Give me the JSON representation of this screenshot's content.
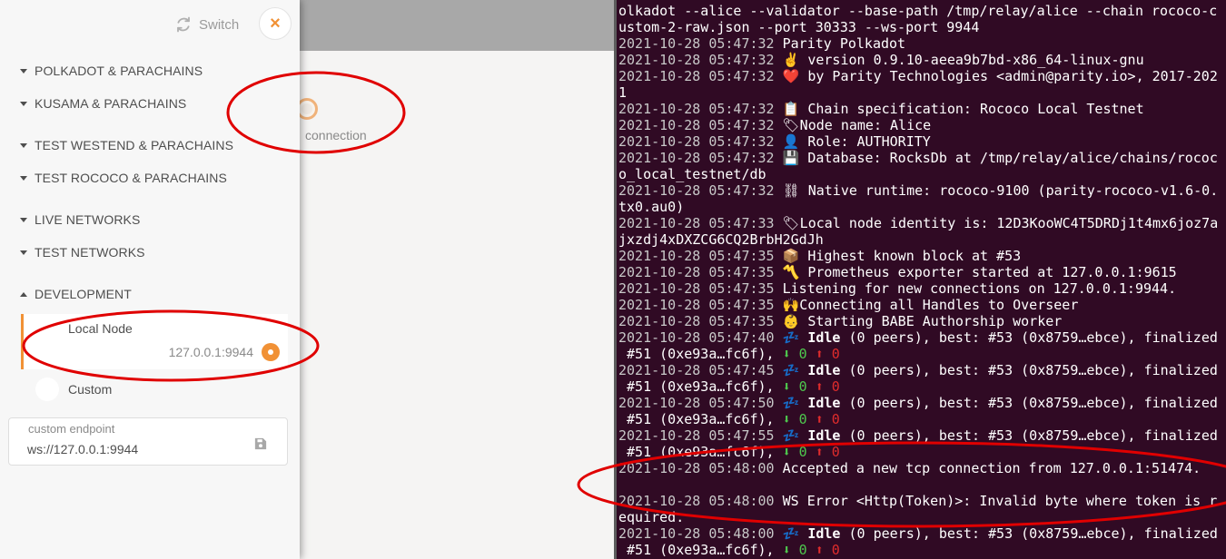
{
  "sidebar": {
    "switch_label": "Switch",
    "close_label": "×",
    "groups": [
      {
        "label": "POLKADOT & PARACHAINS",
        "expanded": false
      },
      {
        "label": "KUSAMA & PARACHAINS",
        "expanded": false
      },
      {
        "label": "TEST WESTEND & PARACHAINS",
        "expanded": false
      },
      {
        "label": "TEST ROCOCO & PARACHAINS",
        "expanded": false
      },
      {
        "label": "LIVE NETWORKS",
        "expanded": false
      },
      {
        "label": "TEST NETWORKS",
        "expanded": false
      },
      {
        "label": "DEVELOPMENT",
        "expanded": true
      }
    ],
    "local_node": {
      "name": "Local Node",
      "url": "127.0.0.1:9944",
      "selected": true
    },
    "custom_node": {
      "name": "Custom",
      "selected": false
    },
    "custom_endpoint": {
      "label": "custom endpoint",
      "value": "ws://127.0.0.1:9944"
    }
  },
  "app": {
    "connection_label": "connection"
  },
  "terminal": {
    "lines": [
      "olkadot --alice --validator --base-path /tmp/relay/alice --chain rococo-c",
      "ustom-2-raw.json --port 30333 --ws-port 9944",
      "2021-10-28 05:47:32 Parity Polkadot",
      "2021-10-28 05:47:32 ✌️ version 0.9.10-aeea9b7bd-x86_64-linux-gnu",
      "2021-10-28 05:47:32 ❤️ by Parity Technologies <admin@parity.io>, 2017-202",
      "1",
      "2021-10-28 05:47:32 📋 Chain specification: Rococo Local Testnet",
      "2021-10-28 05:47:32 🏷Node name: Alice",
      "2021-10-28 05:47:32 👤 Role: AUTHORITY",
      "2021-10-28 05:47:32 💾 Database: RocksDb at /tmp/relay/alice/chains/rococ",
      "o_local_testnet/db",
      "2021-10-28 05:47:32 ⛓ Native runtime: rococo-9100 (parity-rococo-v1.6-0.",
      "tx0.au0)",
      "2021-10-28 05:47:33 🏷Local node identity is: 12D3KooWC4T5DRDj1t4mx6joz7a",
      "jxzdj4xDXZCG6CQ2BrbH2GdJh",
      "2021-10-28 05:47:35 📦 Highest known block at #53",
      "2021-10-28 05:47:35 〽️ Prometheus exporter started at 127.0.0.1:9615",
      "2021-10-28 05:47:35 Listening for new connections on 127.0.0.1:9944.",
      "2021-10-28 05:47:35 🙌Connecting all Handles to Overseer",
      "2021-10-28 05:47:35 👶 Starting BABE Authorship worker",
      "2021-10-28 05:47:40 💤 Idle (0 peers), best: #53 (0x8759…ebce), finalized",
      " #51 (0xe93a…fc6f), ⬇ 0 ⬆ 0",
      "2021-10-28 05:47:45 💤 Idle (0 peers), best: #53 (0x8759…ebce), finalized",
      " #51 (0xe93a…fc6f), ⬇ 0 ⬆ 0",
      "2021-10-28 05:47:50 💤 Idle (0 peers), best: #53 (0x8759…ebce), finalized",
      " #51 (0xe93a…fc6f), ⬇ 0 ⬆ 0",
      "2021-10-28 05:47:55 💤 Idle (0 peers), best: #53 (0x8759…ebce), finalized",
      " #51 (0xe93a…fc6f), ⬇ 0 ⬆ 0",
      "2021-10-28 05:48:00 Accepted a new tcp connection from 127.0.0.1:51474.",
      "",
      "2021-10-28 05:48:00 WS Error <Http(Token)>: Invalid byte where token is r",
      "equired.",
      "2021-10-28 05:48:00 💤 Idle (0 peers), best: #53 (0x8759…ebce), finalized",
      " #51 (0xe93a…fc6f), ⬇ 0 ⬆ 0"
    ]
  },
  "colors": {
    "accent": "#f19135",
    "terminal_bg": "#300a24",
    "annotation": "#e00000"
  }
}
